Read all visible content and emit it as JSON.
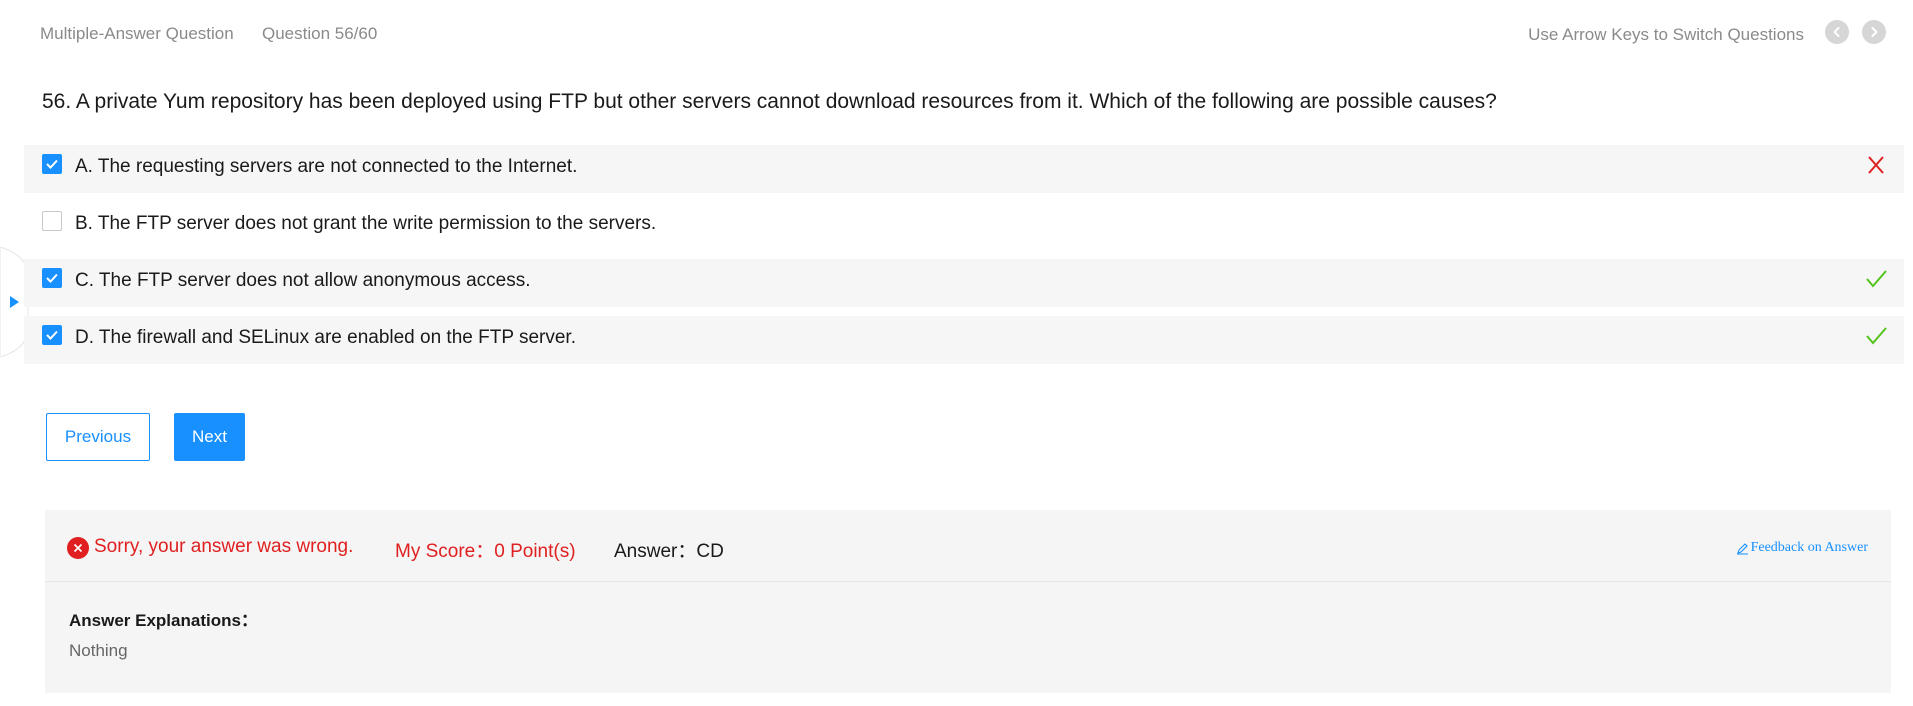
{
  "header": {
    "question_type": "Multiple-Answer Question",
    "question_index": "Question 56/60",
    "hint": "Use Arrow Keys to Switch Questions",
    "prev_icon": "chevron-left-icon",
    "next_icon": "chevron-right-icon"
  },
  "question": {
    "text": "56. A private Yum repository has been deployed using FTP but other servers cannot download resources from it. Which of the following are possible causes?"
  },
  "options": [
    {
      "label": "A. The requesting servers are not connected to the Internet.",
      "checked": true,
      "result": "wrong"
    },
    {
      "label": "B. The FTP server does not grant the write permission to the servers.",
      "checked": false,
      "result": "none"
    },
    {
      "label": "C. The FTP server does not allow anonymous access.",
      "checked": true,
      "result": "correct"
    },
    {
      "label": "D. The firewall and SELinux are enabled on the FTP server.",
      "checked": true,
      "result": "correct"
    }
  ],
  "buttons": {
    "previous": "Previous",
    "next": "Next"
  },
  "result": {
    "message": "Sorry, your answer was wrong.",
    "score": "My Score：0 Point(s)",
    "answer": "Answer：CD",
    "feedback": "Feedback on Answer",
    "explanation_title": "Answer Explanations：",
    "explanation_body": "Nothing"
  },
  "colors": {
    "accent": "#1890ff",
    "error": "#e02020",
    "success": "#52c41a"
  }
}
